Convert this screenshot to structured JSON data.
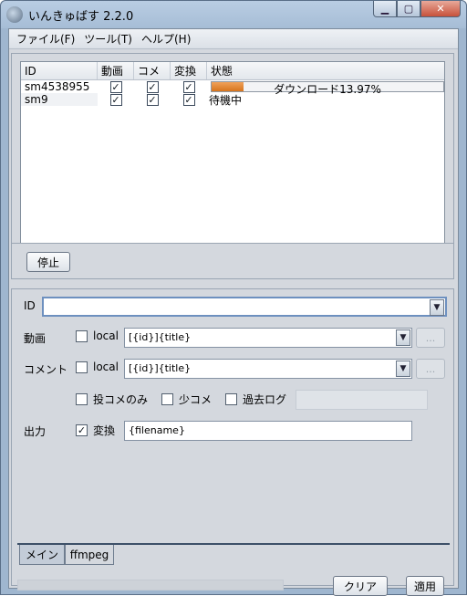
{
  "window": {
    "title": "いんきゅばす 2.2.0",
    "min_label": "▁",
    "max_label": "▢",
    "close_label": "✕"
  },
  "menu": [
    "ファイル(F)",
    "ツール(T)",
    "ヘルプ(H)"
  ],
  "table": {
    "headers": [
      "ID",
      "動画",
      "コメ",
      "変換",
      "状態"
    ],
    "rows": [
      {
        "id": "sm4538955",
        "video": true,
        "comment": true,
        "convert": true,
        "status": "ダウンロード13.97%",
        "progress": 13.97
      },
      {
        "id": "sm9",
        "video": true,
        "comment": true,
        "convert": true,
        "status": "待機中"
      }
    ]
  },
  "actions": {
    "stop_label": "停止"
  },
  "form": {
    "id_label": "ID",
    "id_value": "",
    "video_label": "動画",
    "comment_label": "コメント",
    "local_label": "local",
    "video_pattern": "[{id}]{title}",
    "comment_pattern": "[{id}]{title}",
    "browse_label": "...",
    "options": [
      "投コメのみ",
      "少コメ",
      "過去ログ"
    ],
    "output_label": "出力",
    "convert_label": "変換",
    "output_pattern": "{filename}"
  },
  "tabs": [
    "メイン",
    "ffmpeg"
  ],
  "footer": {
    "clear_label": "クリア",
    "apply_label": "適用"
  }
}
